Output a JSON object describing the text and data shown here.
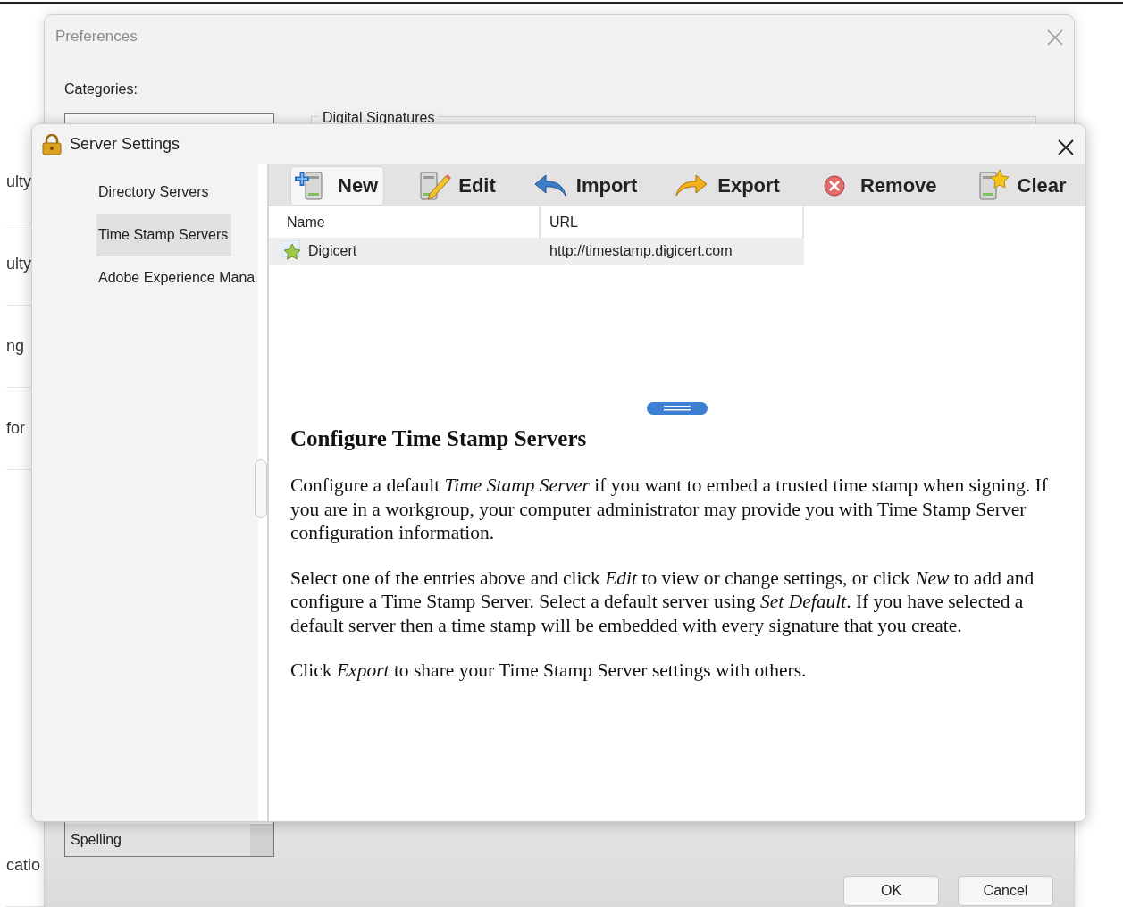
{
  "background_page": {
    "row_texts": [
      "ulty",
      "ulty",
      "ng",
      "for",
      "catio"
    ]
  },
  "preferences": {
    "title": "Preferences",
    "categories_label": "Categories:",
    "categories": [
      {
        "label": "Spelling",
        "selected": false
      }
    ],
    "group_title": "Digital Signatures",
    "buttons": [
      "OK",
      "Cancel"
    ]
  },
  "server_settings": {
    "title": "Server Settings",
    "sidebar": [
      {
        "label": "Directory Servers",
        "selected": false
      },
      {
        "label": "Time Stamp Servers",
        "selected": true
      },
      {
        "label": "Adobe Experience Mana",
        "selected": false
      }
    ],
    "toolbar": [
      {
        "kind": "new",
        "label": "New",
        "highlighted": true
      },
      {
        "kind": "edit",
        "label": "Edit",
        "highlighted": false
      },
      {
        "kind": "import",
        "label": "Import",
        "highlighted": false
      },
      {
        "kind": "export",
        "label": "Export",
        "highlighted": false
      },
      {
        "kind": "remove",
        "label": "Remove",
        "highlighted": false
      },
      {
        "kind": "clear",
        "label": "Clear",
        "highlighted": false
      }
    ],
    "table": {
      "columns": [
        "Name",
        "URL"
      ],
      "rows": [
        {
          "name": "Digicert",
          "url": "http://timestamp.digicert.com",
          "selected": true
        }
      ]
    },
    "help": {
      "heading": "Configure Time Stamp Servers",
      "paragraphs": [
        "Configure a default *Time Stamp Server* if you want to embed a trusted time stamp when signing. If you are in a workgroup, your computer administrator may provide you with Time Stamp Server configuration information.",
        "Select one of the entries above and click *Edit* to view or change settings, or click *New* to add and configure a Time Stamp Server. Select a default server using *Set Default*. If you have selected a default server then a time stamp will be embedded with every signature that you create.",
        "Click *Export* to share your Time Stamp Server settings with others."
      ]
    }
  }
}
